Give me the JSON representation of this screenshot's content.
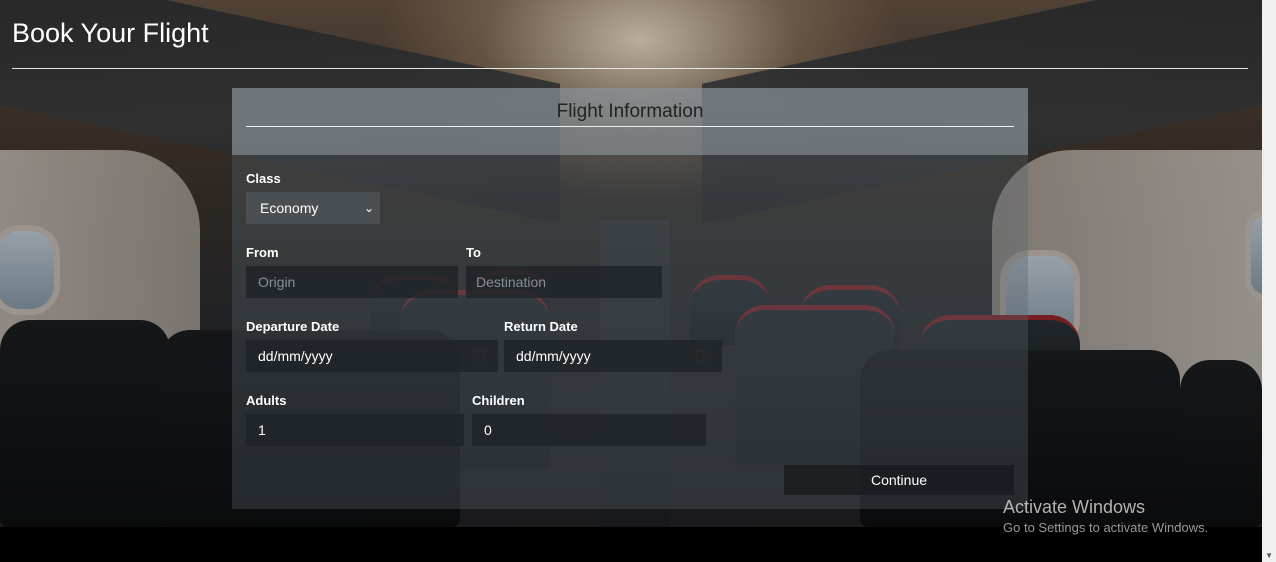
{
  "header": {
    "title": "Book Your Flight"
  },
  "form": {
    "title": "Flight Information",
    "class": {
      "label": "Class",
      "selected": "Economy"
    },
    "from": {
      "label": "From",
      "placeholder": "Origin"
    },
    "to": {
      "label": "To",
      "placeholder": "Destination"
    },
    "departure_date": {
      "label": "Departure Date",
      "value": "dd/mm/yyyy"
    },
    "return_date": {
      "label": "Return Date",
      "value": "dd/mm/yyyy"
    },
    "adults": {
      "label": "Adults",
      "value": "1"
    },
    "children": {
      "label": "Children",
      "value": "0"
    },
    "continue_label": "Continue"
  },
  "watermark": {
    "title": "Activate Windows",
    "subtitle": "Go to Settings to activate Windows."
  },
  "icons": {
    "select_arrow": "chevron-down-icon",
    "date_picker": "calendar-icon",
    "scroll_down": "scroll-down-arrow-icon"
  },
  "colors": {
    "panel_header": "#96a0a8",
    "field_bg": "#1e2328",
    "select_bg": "#4a4f53",
    "seat_accent": "#9c2a2e"
  }
}
